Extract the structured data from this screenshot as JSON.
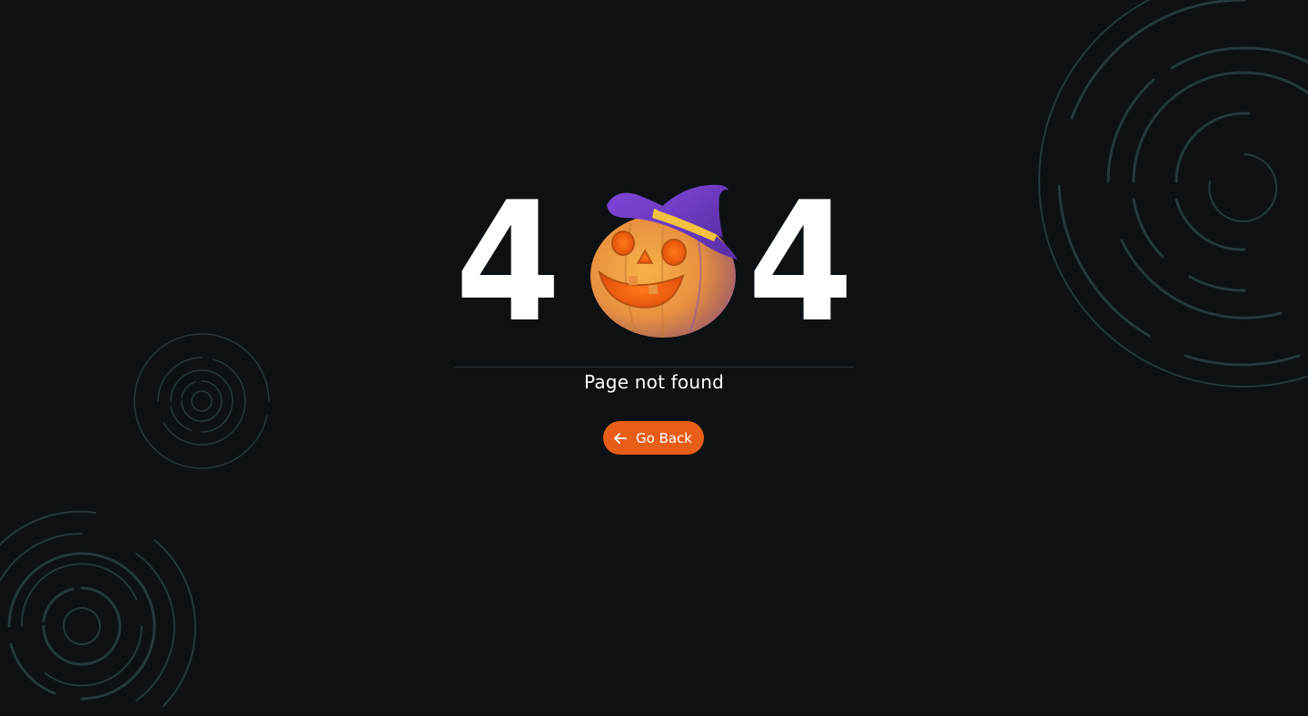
{
  "error": {
    "code_left_digit": "4",
    "code_middle_icon": "jack-o-lantern-witch-hat-icon",
    "code_right_digit": "4",
    "message": "Page not found"
  },
  "actions": {
    "go_back_label": "Go Back",
    "go_back_icon": "arrow-left-icon"
  },
  "colors": {
    "background": "#0d1114",
    "accent": "#e85d17",
    "text": "#ffffff",
    "decoration_rings": "#26383b"
  }
}
